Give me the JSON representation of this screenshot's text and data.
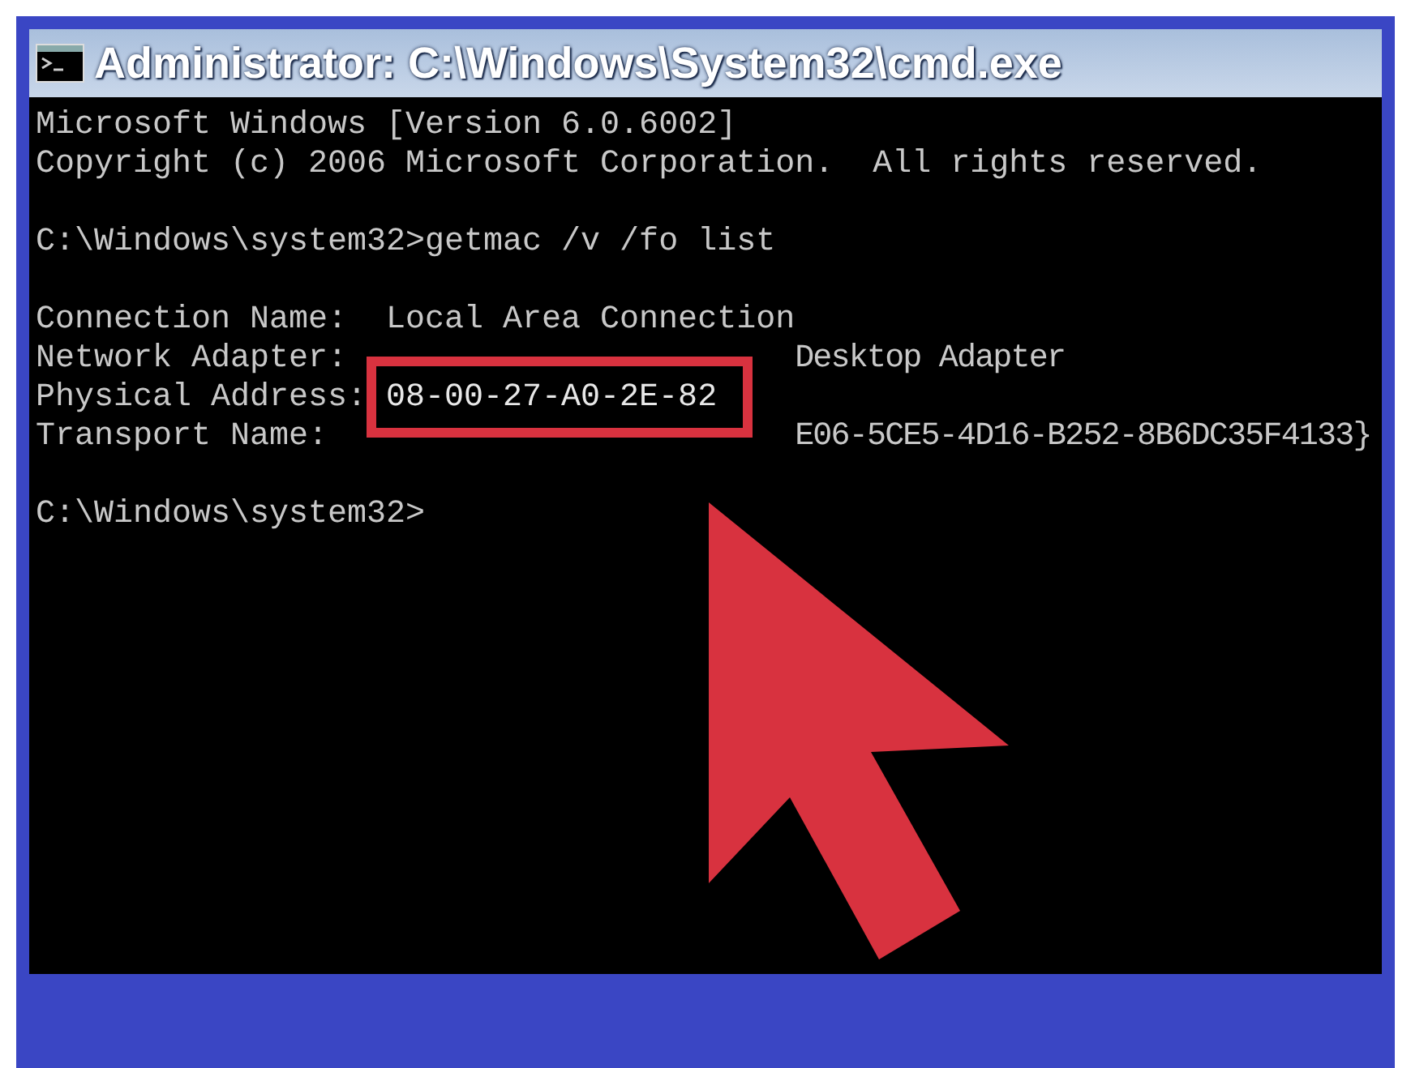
{
  "window": {
    "title": "Administrator: C:\\Windows\\System32\\cmd.exe"
  },
  "console": {
    "lines": [
      {
        "kind": "text",
        "text": "Microsoft Windows [Version 6.0.6002]"
      },
      {
        "kind": "text",
        "text": "Copyright (c) 2006 Microsoft Corporation.  All rights reserved."
      },
      {
        "kind": "blank"
      },
      {
        "kind": "text",
        "text": "C:\\Windows\\system32>getmac /v /fo list"
      },
      {
        "kind": "blank"
      },
      {
        "kind": "field",
        "label": "Connection Name:",
        "value": "Local Area Connection"
      },
      {
        "kind": "obscured",
        "label": "Network Adapter:",
        "value": "Desktop Adapter"
      },
      {
        "kind": "highlighted",
        "label": "Physical Address:",
        "value": "08-00-27-A0-2E-82"
      },
      {
        "kind": "obscured",
        "label": "Transport Name:",
        "value": "E06-5CE5-4D16-B252-8B6DC35F4133}"
      },
      {
        "kind": "blank"
      },
      {
        "kind": "text",
        "text": "C:\\Windows\\system32>"
      }
    ]
  }
}
